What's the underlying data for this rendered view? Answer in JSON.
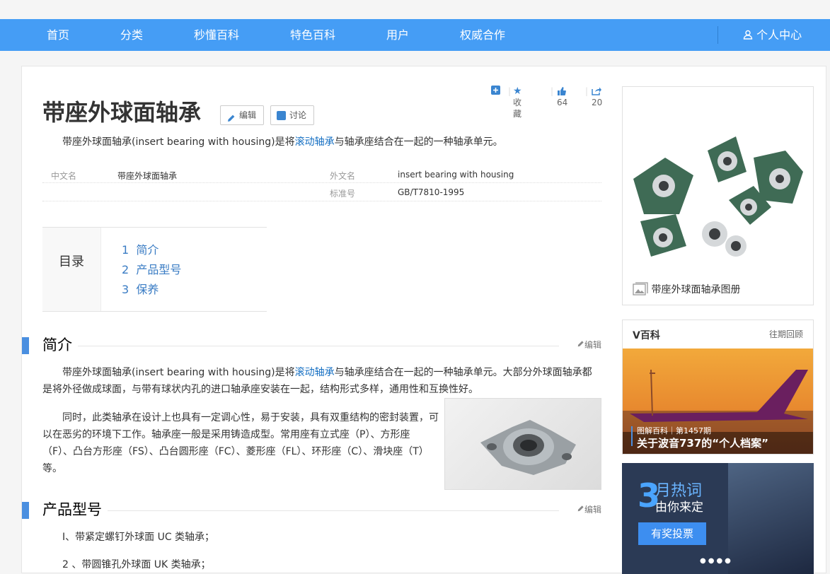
{
  "nav": {
    "items": [
      "首页",
      "分类",
      "秒懂百科",
      "特色百科",
      "用户",
      "权威合作"
    ],
    "user": "个人中心"
  },
  "entry": {
    "title": "带座外球面轴承",
    "edit": "编辑",
    "discuss": "讨论"
  },
  "actions": {
    "fav": "收藏",
    "likes": "64",
    "shares": "20"
  },
  "summary": {
    "pre": "带座外球面轴承(insert bearing with housing)是将",
    "link": "滚动轴承",
    "post": "与轴承座结合在一起的一种轴承单元。"
  },
  "basic_info": [
    {
      "k1": "中文名",
      "v1": "带座外球面轴承",
      "k2": "外文名",
      "v2": "insert bearing with housing"
    },
    {
      "k1": "",
      "v1": "",
      "k2": "标准号",
      "v2": "GB/T7810-1995"
    }
  ],
  "toc": {
    "label": "目录",
    "items": [
      {
        "num": "1",
        "text": "简介"
      },
      {
        "num": "2",
        "text": "产品型号"
      },
      {
        "num": "3",
        "text": "保养"
      }
    ]
  },
  "sections": [
    {
      "title": "简介",
      "edit": "编辑"
    },
    {
      "title": "产品型号",
      "edit": "编辑"
    }
  ],
  "intro": {
    "p1_pre": "带座外球面轴承(insert bearing with housing)是将",
    "p1_link": "滚动轴承",
    "p1_post": "与轴承座结合在一起的一种轴承单元。大部分外球面轴承都是将外径做成球面，与带有球状内孔的进口轴承座安装在一起，结构形式多样，通用性和互换性好。",
    "p2": "同时，此类轴承在设计上也具有一定调心性，易于安装，具有双重结构的密封装置，可以在恶劣的环境下工作。轴承座一般是采用铸造成型。常用座有立式座（P）、方形座（F）、凸台方形座（FS）、凸台圆形座（FC）、菱形座（FL）、环形座（C）、滑块座（T）等。"
  },
  "models": [
    "Ⅰ、带紧定螺钉外球面 UC 类轴承；",
    "2 、带圆锥孔外球面 UK 类轴承；"
  ],
  "album": {
    "caption": "带座外球面轴承图册"
  },
  "vbaike": {
    "title": "V百科",
    "more": "往期回顾",
    "tag": "图解百科｜第1457期",
    "headline": "关于波音737的“个人档案”"
  },
  "hot": {
    "num": "3",
    "line1": "月热词",
    "line2": "由你来定",
    "btn": "有奖投票"
  },
  "colors": {
    "nav": "#459df5",
    "link": "#136ec2",
    "accent": "#4a8fe0"
  }
}
